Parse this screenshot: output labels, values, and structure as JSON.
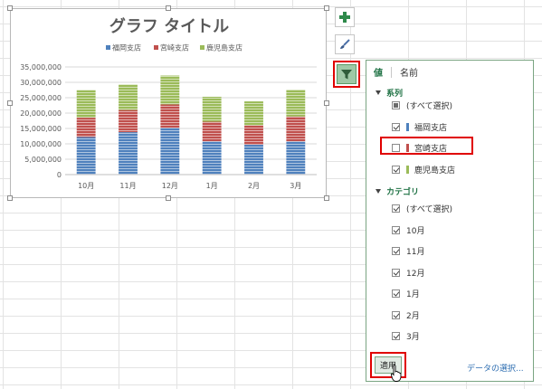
{
  "chart": {
    "title": "グラフ タイトル"
  },
  "chart_data": {
    "type": "bar",
    "stacked": true,
    "title": "グラフ タイトル",
    "categories": [
      "10月",
      "11月",
      "12月",
      "1月",
      "2月",
      "3月"
    ],
    "series": [
      {
        "name": "福岡支店",
        "color": "#4f81bd",
        "values": [
          12200000,
          13800000,
          15200000,
          10800000,
          9700000,
          10800000
        ]
      },
      {
        "name": "宮崎支店",
        "color": "#c0504d",
        "values": [
          6300000,
          7200000,
          7600000,
          6400000,
          6300000,
          8100000
        ]
      },
      {
        "name": "鹿児島支店",
        "color": "#9bbb59",
        "values": [
          9000000,
          8300000,
          9400000,
          8100000,
          7800000,
          8700000
        ]
      }
    ],
    "yticks": [
      "0",
      "5,000,000",
      "10,000,000",
      "15,000,000",
      "20,000,000",
      "25,000,000",
      "30,000,000",
      "35,000,000"
    ],
    "ylim": [
      0,
      35000000
    ],
    "legend_position": "top",
    "grid": true
  },
  "side_buttons": {
    "elements": "chart-elements",
    "styles": "chart-styles",
    "filters": "chart-filters"
  },
  "panel": {
    "tab_values": "値",
    "tab_names": "名前",
    "series_header": "系列",
    "series_items": [
      {
        "label": "(すべて選択)",
        "state": "partial"
      },
      {
        "label": "福岡支店",
        "state": "checked",
        "color": "#4f81bd"
      },
      {
        "label": "宮崎支店",
        "state": "unchecked",
        "color": "#c0504d"
      },
      {
        "label": "鹿児島支店",
        "state": "checked",
        "color": "#9bbb59"
      }
    ],
    "category_header": "カテゴリ",
    "category_items": [
      {
        "label": "(すべて選択)",
        "state": "checked"
      },
      {
        "label": "10月",
        "state": "checked"
      },
      {
        "label": "11月",
        "state": "checked"
      },
      {
        "label": "12月",
        "state": "checked"
      },
      {
        "label": "1月",
        "state": "checked"
      },
      {
        "label": "2月",
        "state": "checked"
      },
      {
        "label": "3月",
        "state": "checked"
      }
    ],
    "apply_label": "適用",
    "select_data_link": "データの選択..."
  }
}
